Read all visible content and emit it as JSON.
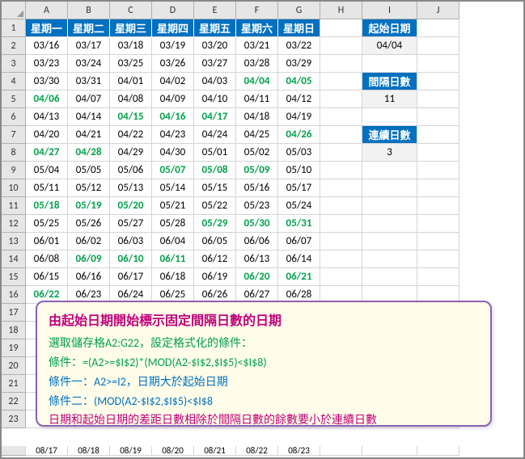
{
  "columns": [
    "A",
    "B",
    "C",
    "D",
    "E",
    "F",
    "G",
    "H",
    "I",
    "J"
  ],
  "row_numbers": [
    1,
    2,
    3,
    4,
    5,
    6,
    7,
    8,
    9,
    10,
    11,
    12,
    13,
    14,
    15,
    16,
    17,
    18,
    19,
    20,
    21,
    22,
    23
  ],
  "weekday_headers": [
    "星期一",
    "星期二",
    "星期三",
    "星期四",
    "星期五",
    "星期六",
    "星期日"
  ],
  "side": {
    "start_date_label": "起始日期",
    "start_date_value": "04/04",
    "interval_label": "間隔日數",
    "interval_value": "11",
    "consec_label": "連續日數",
    "consec_value": "3"
  },
  "dates": [
    [
      {
        "v": "03/16"
      },
      {
        "v": "03/17"
      },
      {
        "v": "03/18"
      },
      {
        "v": "03/19"
      },
      {
        "v": "03/20"
      },
      {
        "v": "03/21"
      },
      {
        "v": "03/22"
      }
    ],
    [
      {
        "v": "03/23"
      },
      {
        "v": "03/24"
      },
      {
        "v": "03/25"
      },
      {
        "v": "03/26"
      },
      {
        "v": "03/27"
      },
      {
        "v": "03/28"
      },
      {
        "v": "03/29"
      }
    ],
    [
      {
        "v": "03/30"
      },
      {
        "v": "03/31"
      },
      {
        "v": "04/01"
      },
      {
        "v": "04/02"
      },
      {
        "v": "04/03"
      },
      {
        "v": "04/04",
        "g": true
      },
      {
        "v": "04/05",
        "g": true
      }
    ],
    [
      {
        "v": "04/06",
        "g": true
      },
      {
        "v": "04/07"
      },
      {
        "v": "04/08"
      },
      {
        "v": "04/09"
      },
      {
        "v": "04/10"
      },
      {
        "v": "04/11"
      },
      {
        "v": "04/12"
      }
    ],
    [
      {
        "v": "04/13"
      },
      {
        "v": "04/14"
      },
      {
        "v": "04/15",
        "g": true
      },
      {
        "v": "04/16",
        "g": true
      },
      {
        "v": "04/17",
        "g": true
      },
      {
        "v": "04/18"
      },
      {
        "v": "04/19"
      }
    ],
    [
      {
        "v": "04/20"
      },
      {
        "v": "04/21"
      },
      {
        "v": "04/22"
      },
      {
        "v": "04/23"
      },
      {
        "v": "04/24"
      },
      {
        "v": "04/25"
      },
      {
        "v": "04/26",
        "g": true
      }
    ],
    [
      {
        "v": "04/27",
        "g": true
      },
      {
        "v": "04/28",
        "g": true
      },
      {
        "v": "04/29"
      },
      {
        "v": "04/30"
      },
      {
        "v": "05/01"
      },
      {
        "v": "05/02"
      },
      {
        "v": "05/03"
      }
    ],
    [
      {
        "v": "05/04"
      },
      {
        "v": "05/05"
      },
      {
        "v": "05/06"
      },
      {
        "v": "05/07",
        "g": true
      },
      {
        "v": "05/08",
        "g": true
      },
      {
        "v": "05/09",
        "g": true
      },
      {
        "v": "05/10"
      }
    ],
    [
      {
        "v": "05/11"
      },
      {
        "v": "05/12"
      },
      {
        "v": "05/13"
      },
      {
        "v": "05/14"
      },
      {
        "v": "05/15"
      },
      {
        "v": "05/16"
      },
      {
        "v": "05/17"
      }
    ],
    [
      {
        "v": "05/18",
        "g": true
      },
      {
        "v": "05/19",
        "g": true
      },
      {
        "v": "05/20",
        "g": true
      },
      {
        "v": "05/21"
      },
      {
        "v": "05/22"
      },
      {
        "v": "05/23"
      },
      {
        "v": "05/24"
      }
    ],
    [
      {
        "v": "05/25"
      },
      {
        "v": "05/26"
      },
      {
        "v": "05/27"
      },
      {
        "v": "05/28"
      },
      {
        "v": "05/29",
        "g": true
      },
      {
        "v": "05/30",
        "g": true
      },
      {
        "v": "05/31",
        "g": true
      }
    ],
    [
      {
        "v": "06/01"
      },
      {
        "v": "06/02"
      },
      {
        "v": "06/03"
      },
      {
        "v": "06/04"
      },
      {
        "v": "06/05"
      },
      {
        "v": "06/06"
      },
      {
        "v": "06/07"
      }
    ],
    [
      {
        "v": "06/08"
      },
      {
        "v": "06/09",
        "g": true
      },
      {
        "v": "06/10",
        "g": true
      },
      {
        "v": "06/11",
        "g": true
      },
      {
        "v": "06/12"
      },
      {
        "v": "06/13"
      },
      {
        "v": "06/14"
      }
    ],
    [
      {
        "v": "06/15"
      },
      {
        "v": "06/16"
      },
      {
        "v": "06/17"
      },
      {
        "v": "06/18"
      },
      {
        "v": "06/19"
      },
      {
        "v": "06/20",
        "g": true
      },
      {
        "v": "06/21",
        "g": true
      }
    ],
    [
      {
        "v": "06/22",
        "g": true
      },
      {
        "v": "06/23"
      },
      {
        "v": "06/24"
      },
      {
        "v": "06/25"
      },
      {
        "v": "06/26"
      },
      {
        "v": "06/27"
      },
      {
        "v": "06/28"
      }
    ]
  ],
  "callout": {
    "title": "由起始日期開始標示固定間隔日數的日期",
    "line1": "選取儲存格A2:G22，設定格式化的條件：",
    "line2": "條件：=(A2>=$I$2)*(MOD(A2-$I$2,$I$5)<$I$8)",
    "line3": "條件一：A2>=I2，日期大於起始日期",
    "line4": "條件二：(MOD(A2-$I$2,$I$5)<$I$8",
    "line5": "日期和起始日期的差距日數相除於間隔日數的餘數要小於連續日數"
  },
  "bottom_row": [
    "",
    "08/17",
    "08/18",
    "08/19",
    "08/20",
    "08/21",
    "08/22",
    "08/23",
    "",
    "",
    ""
  ]
}
